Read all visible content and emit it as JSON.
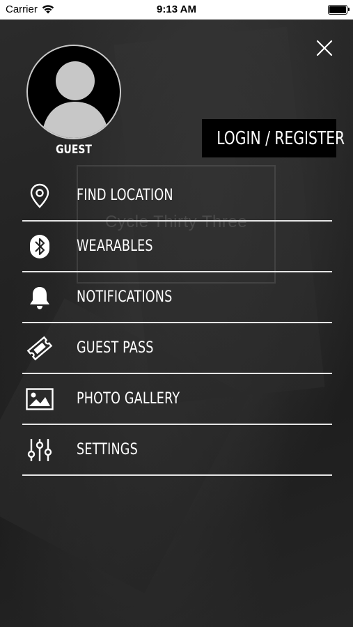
{
  "status_bar": {
    "carrier": "Carrier",
    "time": "9:13 AM"
  },
  "background": {
    "watermark": "Cycle Thirty Three"
  },
  "profile": {
    "name": "GUEST"
  },
  "auth": {
    "login_label": "LOGIN / REGISTER"
  },
  "menu": {
    "items": [
      {
        "label": "FIND LOCATION",
        "icon": "location-pin-icon"
      },
      {
        "label": "WEARABLES",
        "icon": "bluetooth-icon"
      },
      {
        "label": "NOTIFICATIONS",
        "icon": "bell-icon"
      },
      {
        "label": "GUEST PASS",
        "icon": "ticket-icon"
      },
      {
        "label": "PHOTO GALLERY",
        "icon": "image-icon"
      },
      {
        "label": "SETTINGS",
        "icon": "sliders-icon"
      }
    ]
  },
  "colors": {
    "accent": "#ffffff",
    "button_bg": "#000000",
    "divider": "#e6e6e6"
  }
}
